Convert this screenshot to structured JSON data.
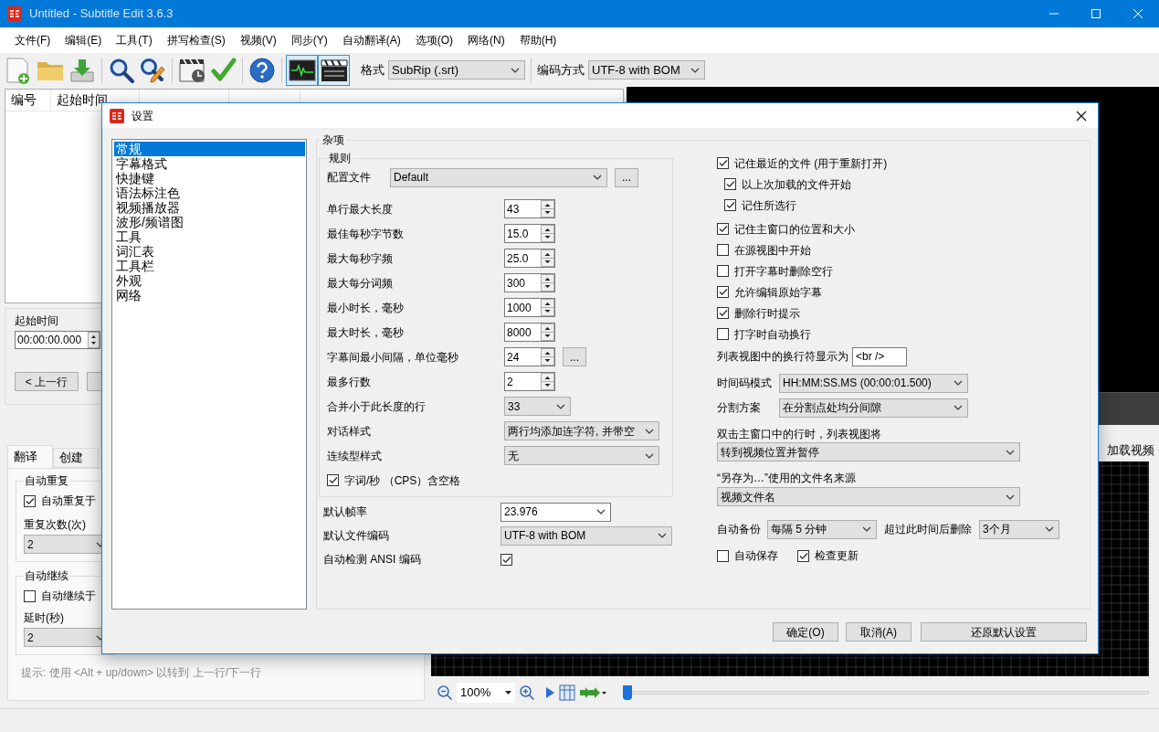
{
  "window": {
    "title": "Untitled - Subtitle Edit 3.6.3"
  },
  "menu": [
    "文件(F)",
    "编辑(E)",
    "工具(T)",
    "拼写检查(S)",
    "视频(V)",
    "同步(Y)",
    "自动翻译(A)",
    "选项(O)",
    "网络(N)",
    "帮助(H)"
  ],
  "toolbar": {
    "tools": [
      {
        "kind": "new"
      },
      {
        "kind": "open"
      },
      {
        "kind": "download"
      },
      {
        "kind": "find"
      },
      {
        "kind": "replace"
      },
      {
        "kind": "sync"
      },
      {
        "kind": "check"
      },
      {
        "kind": "help"
      }
    ],
    "toggles": [
      {
        "kind": "waveform",
        "selected": true
      },
      {
        "kind": "video",
        "selected": true
      }
    ],
    "format_label": "格式",
    "format": "SubRip (.srt)",
    "encoding_label": "编码方式",
    "encoding": "UTF-8 with BOM"
  },
  "subtitle_list": {
    "columns": [
      "编号",
      "起始时间"
    ]
  },
  "edit": {
    "start_label": "起始时间",
    "start_time": "00:00:00.000",
    "prev": "< 上一行"
  },
  "tabs": [
    {
      "label": "翻译",
      "selected": true
    },
    {
      "label": "创建",
      "selected": false
    }
  ],
  "auto_repeat": {
    "title": "自动重复",
    "option": {
      "label": "自动重复于",
      "checked": true
    },
    "count_label": "重复次数(次)",
    "count": "2"
  },
  "auto_continue": {
    "title": "自动继续",
    "option": {
      "label": "自动继续于",
      "checked": false
    },
    "delay_label": "延时(秒)",
    "delay": "2"
  },
  "hint": "提示: 使用 <Alt + up/down> 以转到 上一行/下一行",
  "video": {
    "status": "加载视频"
  },
  "waveform": {
    "zoom": "100%",
    "position": {
      "level": 0
    }
  },
  "dialog": {
    "title": "设置",
    "categories": [
      {
        "label": "常规",
        "selected": true
      },
      {
        "label": "字幕格式",
        "selected": false
      },
      {
        "label": "快捷键",
        "selected": false
      },
      {
        "label": "语法标注色",
        "selected": false
      },
      {
        "label": "视频播放器",
        "selected": false
      },
      {
        "label": "波形/频谱图",
        "selected": false
      },
      {
        "label": "工具",
        "selected": false
      },
      {
        "label": "词汇表",
        "selected": false
      },
      {
        "label": "工具栏",
        "selected": false
      },
      {
        "label": "外观",
        "selected": false
      },
      {
        "label": "网络",
        "selected": false
      }
    ],
    "section_title": "杂项",
    "rules": {
      "title": "规则",
      "profile_label": "配置文件",
      "profile": "Default",
      "profile_button": "...",
      "fields": [
        {
          "kind": "spin",
          "label": "单行最大长度",
          "value": "43"
        },
        {
          "kind": "spin",
          "label": "最佳每秒字节数",
          "value": "15.0"
        },
        {
          "kind": "spin",
          "label": "最大每秒字频",
          "value": "25.0"
        },
        {
          "kind": "spin",
          "label": "最大每分词频",
          "value": "300"
        },
        {
          "kind": "spin",
          "label": "最小时长，毫秒",
          "value": "1000"
        },
        {
          "kind": "spin",
          "label": "最大时长，毫秒",
          "value": "8000"
        },
        {
          "kind": "spin",
          "label": "字幕间最小间隔，单位毫秒",
          "value": "24",
          "button": "..."
        },
        {
          "kind": "spin",
          "label": "最多行数",
          "value": "2"
        },
        {
          "kind": "short_select",
          "label": "合并小于此长度的行",
          "value": "33"
        },
        {
          "kind": "select",
          "label": "对话样式",
          "value": "两行均添加连字符, 并带空"
        },
        {
          "kind": "select",
          "label": "连续型样式",
          "value": "无"
        }
      ],
      "cps": {
        "label": "字词/秒 （CPS）含空格",
        "checked": true
      }
    },
    "frame_rate_label": "默认帧率",
    "frame_rate": "23.976",
    "encoding_label": "默认文件编码",
    "encoding": "UTF-8 with BOM",
    "ansi": {
      "label": "自动检测 ANSI 编码",
      "checked": true
    },
    "options": [
      {
        "label": "记住最近的文件 (用于重新打开)",
        "checked": true,
        "children": [
          {
            "label": "以上次加载的文件开始",
            "checked": true
          },
          {
            "label": "记住所选行",
            "checked": true
          }
        ]
      },
      {
        "label": "记住主窗口的位置和大小",
        "checked": true
      },
      {
        "label": "在源视图中开始",
        "checked": false
      },
      {
        "label": "打开字幕时删除空行",
        "checked": false
      },
      {
        "label": "允许编辑原始字幕",
        "checked": true
      },
      {
        "label": "删除行时提示",
        "checked": true
      },
      {
        "label": "打字时自动换行",
        "checked": false
      }
    ],
    "linebreak_label": "列表视图中的换行符显示为",
    "linebreak": "<br />",
    "timecode_label": "时间码模式",
    "timecode": "HH:MM:SS.MS (00:00:01.500)",
    "split_label": "分割方案",
    "split": "在分割点处均分间隙",
    "dblclick_label": "双击主窗口中的行时，列表视图将",
    "dblclick": "转到视频位置并暂停",
    "saveas_label": "“另存为…”使用的文件名来源",
    "saveas": "视频文件名",
    "backup_label": "自动备份",
    "backup": "每隔 5 分钟",
    "delete_label": "超过此时间后删除",
    "delete": "3个月",
    "autosave": {
      "label": "自动保存",
      "checked": false
    },
    "check_updates": {
      "label": "检查更新",
      "checked": true
    },
    "buttons": [
      "确定(O)",
      "取消(A)",
      "还原默认设置"
    ]
  }
}
